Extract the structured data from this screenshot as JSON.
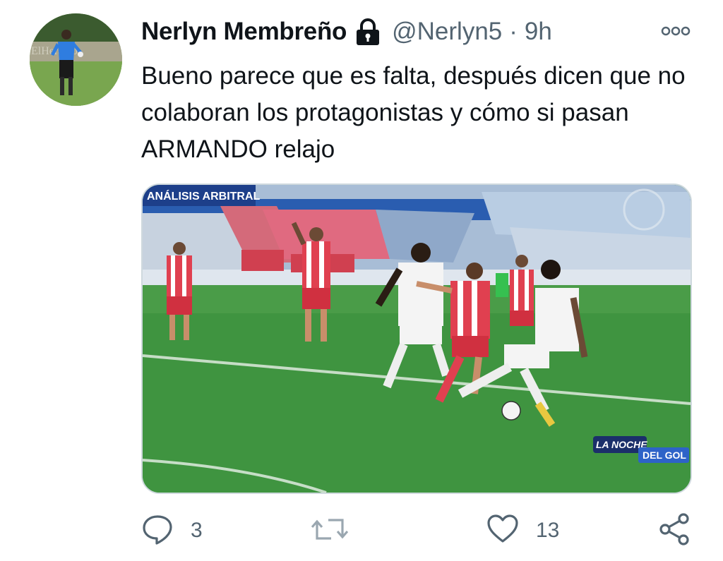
{
  "tweet": {
    "display_name": "Nerlyn Membreño",
    "handle": "@Nerlyn5",
    "separator": "·",
    "time": "9h",
    "text": "Bueno parece que es falta, después dicen que no colaboran los protagonistas y cómo si pasan ARMANDO relajo"
  },
  "avatar": {
    "watermark": "ElHeraldo"
  },
  "media": {
    "banner_text": "ANÁLISIS ARBITRAL",
    "logo_line1": "LA NOCHE",
    "logo_line2": "DEL GOL"
  },
  "actions": {
    "reply_count": "3",
    "like_count": "13"
  },
  "colors": {
    "text_primary": "#0f1419",
    "text_secondary": "#536471",
    "grass": "#3e8f3e"
  },
  "icons": [
    "lock-icon",
    "more-icon",
    "reply-icon",
    "retweet-icon",
    "like-icon",
    "share-icon"
  ]
}
